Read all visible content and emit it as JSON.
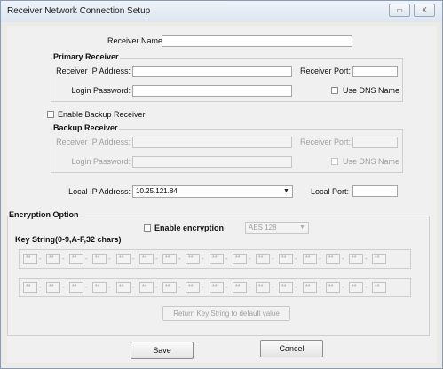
{
  "window": {
    "title": "Receiver Network Connection Setup",
    "minimize_label": "",
    "close_label": "X"
  },
  "receiver_name": {
    "label": "Receiver Name:",
    "value": ""
  },
  "primary": {
    "title": "Primary Receiver",
    "ip_label": "Receiver IP Address:",
    "ip_value": "",
    "port_label": "Receiver Port:",
    "port_value": "",
    "password_label": "Login Password:",
    "password_value": "",
    "dns_label": "Use DNS Name"
  },
  "backup_enable": {
    "label": "Enable Backup Receiver"
  },
  "backup": {
    "title": "Backup Receiver",
    "ip_label": "Receiver IP Address:",
    "port_label": "Receiver Port:",
    "password_label": "Login Password:",
    "dns_label": "Use DNS Name"
  },
  "local": {
    "ip_label": "Local IP Address:",
    "ip_value": "10.25.121.84",
    "port_label": "Local Port:",
    "port_value": ""
  },
  "encryption": {
    "title": "Encryption Option",
    "enable_label": "Enable encryption",
    "algorithm": "AES 128",
    "key_title": "Key String(0-9,A-F,32 chars)",
    "key_row1": [
      "**",
      "**",
      "**",
      "**",
      "**",
      "**",
      "**",
      "**",
      "**",
      "**",
      "**",
      "**",
      "**",
      "**",
      "**",
      "**"
    ],
    "key_row2": [
      "**",
      "**",
      "**",
      "**",
      "**",
      "**",
      "**",
      "**",
      "**",
      "**",
      "**",
      "**",
      "**",
      "**",
      "**",
      "**"
    ],
    "reset_label": "Return Key String to default value"
  },
  "buttons": {
    "save": "Save",
    "cancel": "Cancel"
  }
}
